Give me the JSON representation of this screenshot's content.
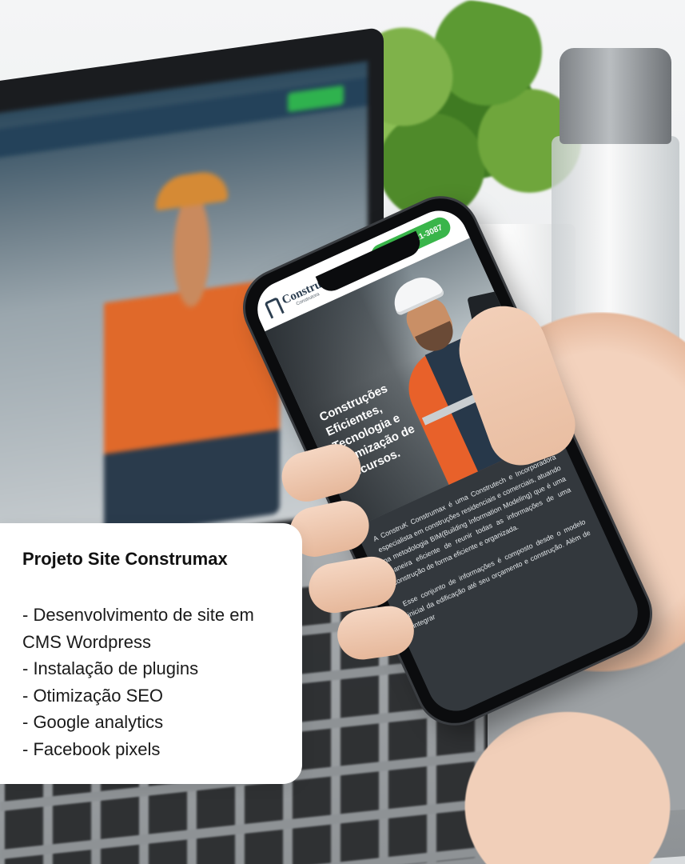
{
  "card": {
    "title": "Projeto Site Construmax",
    "items": [
      "- Desenvolvimento de site em CMS Wordpress",
      "- Instalação de plugins",
      "- Otimização SEO",
      "- Google analytics",
      "- Facebook pixels"
    ]
  },
  "phone": {
    "logo_name": "ConstruK",
    "logo_sub": "Construtora",
    "phone_number": "(11) 91021-3087",
    "hero_title": "Construções Eficientes, Tecnologia e Otimização de Recursos.",
    "paragraphs": [
      "A ConstruK Construmax é uma Construtech e Incorporadora especialista em construções residenciais e comerciais, atuando na metodologia BIM(Building Information Modeling) que é uma maneira eficiente de reunir todas as informações de uma construção de forma eficiente e organizada.",
      "Esse conjunto de informações é composto desde o modelo inicial da edificação até seu orçamento e construção. Além de integrar"
    ]
  },
  "colors": {
    "accent_green": "#39b54a",
    "vest_orange": "#e8612a",
    "card_bg": "#ffffff"
  }
}
